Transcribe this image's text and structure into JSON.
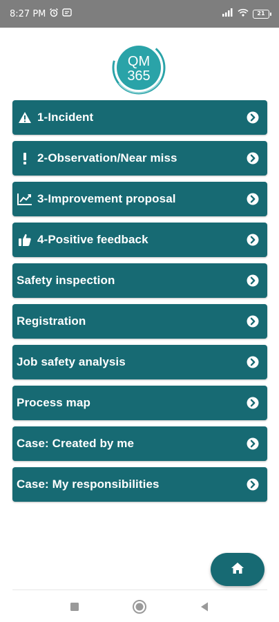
{
  "status_bar": {
    "time": "8:27 PM",
    "battery": "21",
    "icons": [
      "alarm-icon",
      "notification-icon",
      "signal-icon",
      "wifi-icon",
      "battery-icon"
    ]
  },
  "logo": {
    "line1": "QM",
    "line2": "365"
  },
  "colors": {
    "primary": "#176a73",
    "status_bar": "#7e7e7e",
    "logo_ring": "#2aa3a8"
  },
  "menu": {
    "items": [
      {
        "label": "1-Incident",
        "icon": "warning-icon"
      },
      {
        "label": "2-Observation/Near miss",
        "icon": "exclamation-icon"
      },
      {
        "label": "3-Improvement proposal",
        "icon": "chart-line-icon"
      },
      {
        "label": "4-Positive feedback",
        "icon": "thumbs-up-icon"
      },
      {
        "label": "Safety inspection"
      },
      {
        "label": "Registration"
      },
      {
        "label": "Job safety analysis"
      },
      {
        "label": "Process map"
      },
      {
        "label": "Case: Created by me"
      },
      {
        "label": "Case: My responsibilities"
      }
    ]
  },
  "home_button": {
    "icon": "home-icon"
  },
  "nav_bar": {
    "buttons": [
      "recent-apps-icon",
      "home-circle-icon",
      "back-icon"
    ]
  }
}
